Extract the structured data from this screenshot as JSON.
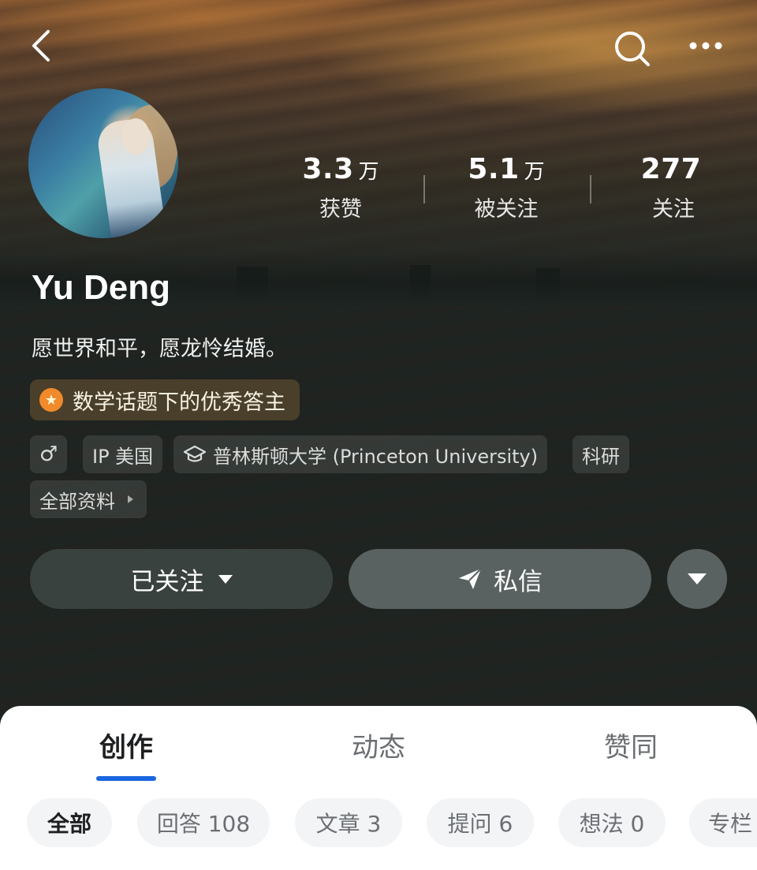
{
  "profile": {
    "name": "Yu Deng",
    "bio": "愿世界和平，愿龙怜结婚。",
    "badge": "数学话题下的优秀答主"
  },
  "stats": [
    {
      "value": "3.3",
      "unit": "万",
      "label": "获赞"
    },
    {
      "value": "5.1",
      "unit": "万",
      "label": "被关注"
    },
    {
      "value": "277",
      "unit": "",
      "label": "关注"
    }
  ],
  "tags": {
    "gender": "♂",
    "ip": "IP 美国",
    "school": "普林斯顿大学 (Princeton University)",
    "field": "科研",
    "all_info": "全部资料"
  },
  "actions": {
    "follow": "已关注",
    "message": "私信"
  },
  "tabs": [
    "创作",
    "动态",
    "赞同"
  ],
  "filters": [
    "全部",
    "回答 108",
    "文章 3",
    "提问 6",
    "想法 0",
    "专栏"
  ],
  "icons": {
    "back": "back-icon",
    "search": "search-icon",
    "more": "more-icon",
    "medal": "medal-icon",
    "graduation": "graduation-cap-icon",
    "send": "send-icon"
  },
  "colors": {
    "accent": "#1a66e0",
    "badge_bg": "#4a3f2a",
    "medal": "#f08a2a"
  }
}
